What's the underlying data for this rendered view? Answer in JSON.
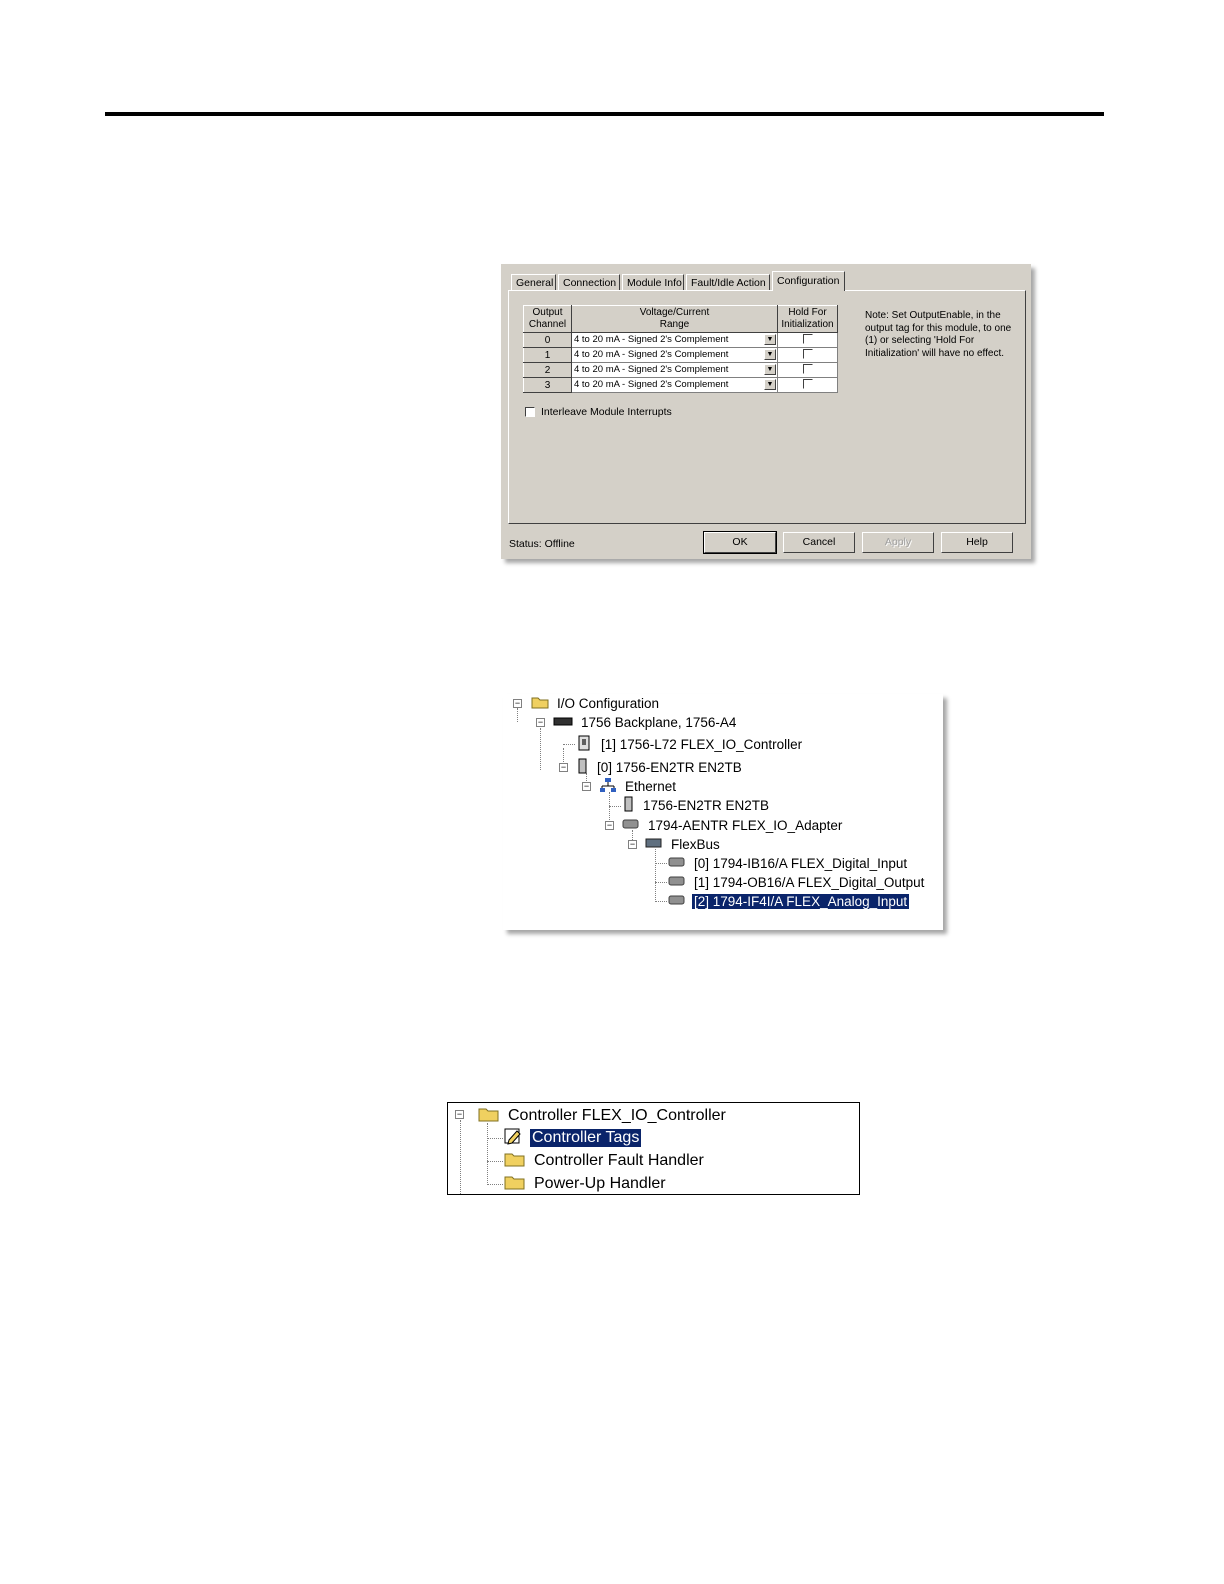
{
  "dialog": {
    "tabs": [
      "General",
      "Connection",
      "Module Info",
      "Fault/Idle Action",
      "Configuration"
    ],
    "active_tab": "Configuration",
    "grid": {
      "col_output_channel": [
        "Output",
        "Channel"
      ],
      "col_range": [
        "Voltage/Current",
        "Range"
      ],
      "col_hold": [
        "Hold For",
        "Initialization"
      ],
      "rows": [
        {
          "channel": "0",
          "range": "4 to 20 mA - Signed 2's Complement",
          "hold": false
        },
        {
          "channel": "1",
          "range": "4 to 20 mA - Signed 2's Complement",
          "hold": false
        },
        {
          "channel": "2",
          "range": "4 to 20 mA - Signed 2's Complement",
          "hold": false
        },
        {
          "channel": "3",
          "range": "4 to 20 mA - Signed 2's Complement",
          "hold": false
        }
      ]
    },
    "note": "Note: Set OutputEnable, in the output tag for this module, to one (1) or selecting 'Hold For Initialization' will have no effect.",
    "interleave_label": "Interleave Module Interrupts",
    "interleave_checked": false,
    "status_label": "Status:",
    "status_value": "Offline",
    "buttons": {
      "ok": "OK",
      "cancel": "Cancel",
      "apply": "Apply",
      "help": "Help"
    }
  },
  "io_tree": {
    "root": "I/O Configuration",
    "backplane": "1756 Backplane, 1756-A4",
    "controller": "[1] 1756-L72 FLEX_IO_Controller",
    "en2tr": "[0] 1756-EN2TR EN2TB",
    "ethernet": "Ethernet",
    "en2tr_eth": "1756-EN2TR EN2TB",
    "adapter": "1794-AENTR FLEX_IO_Adapter",
    "flexbus": "FlexBus",
    "modules": [
      "[0] 1794-IB16/A FLEX_Digital_Input",
      "[1] 1794-OB16/A FLEX_Digital_Output",
      "[2] 1794-IF4I/A FLEX_Analog_Input"
    ],
    "selected": "[2] 1794-IF4I/A FLEX_Analog_Input"
  },
  "controller_tree": {
    "root": "Controller FLEX_IO_Controller",
    "items": [
      "Controller Tags",
      "Controller Fault Handler",
      "Power-Up Handler"
    ],
    "selected": "Controller Tags"
  },
  "icons": {
    "folder": "folder-icon",
    "backplane": "backplane-icon",
    "module": "module-icon",
    "network": "network-icon",
    "tags": "tags-icon"
  }
}
